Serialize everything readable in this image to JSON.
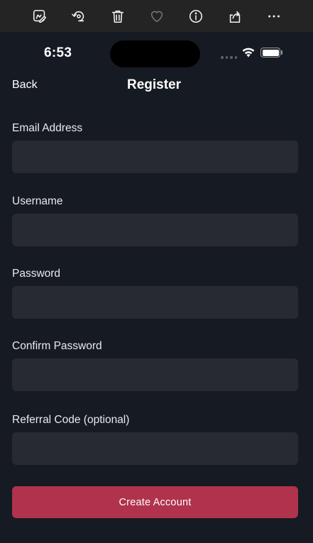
{
  "toolbar": {
    "icons": [
      "markup-icon",
      "rotate-icon",
      "trash-icon",
      "heart-icon",
      "info-icon",
      "share-icon",
      "more-icon"
    ]
  },
  "status_bar": {
    "time": "6:53"
  },
  "nav": {
    "back_label": "Back",
    "title": "Register"
  },
  "form": {
    "fields": [
      {
        "label": "Email Address",
        "value": "",
        "placeholder": ""
      },
      {
        "label": "Username",
        "value": "",
        "placeholder": ""
      },
      {
        "label": "Password",
        "value": "",
        "placeholder": ""
      },
      {
        "label": "Confirm Password",
        "value": "",
        "placeholder": ""
      },
      {
        "label": "Referral Code (optional)",
        "value": "",
        "placeholder": ""
      }
    ],
    "submit_label": "Create Account"
  },
  "colors": {
    "background": "#161a23",
    "input_bg": "#272a33",
    "accent": "#b0324c",
    "toolbar_bg": "#242424"
  }
}
